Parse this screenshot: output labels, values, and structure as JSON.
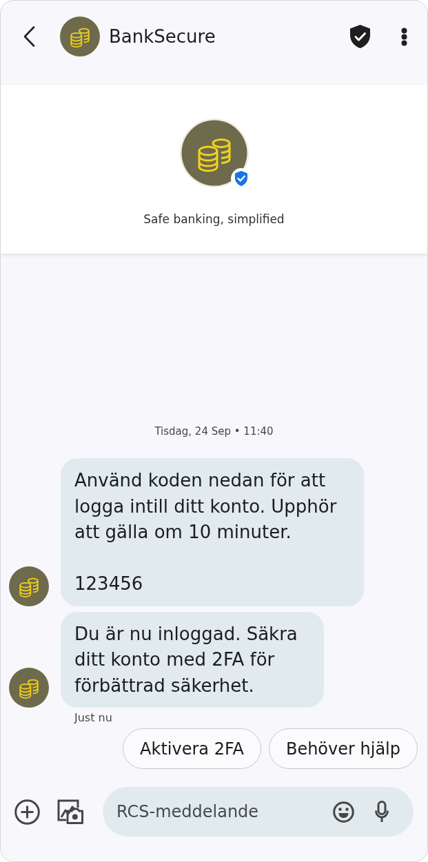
{
  "header": {
    "title": "BankSecure"
  },
  "profile": {
    "tagline": "Safe banking, simplified",
    "verified": true
  },
  "conversation": {
    "timestamp": "Tisdag, 24 Sep • 11:40",
    "messages": [
      {
        "text": "Använd koden nedan för att logga intill ditt konto. Upphör att gälla om 10 minuter.\n\n123456"
      },
      {
        "text": "Du är nu inloggad. Säkra ditt konto med 2FA för förbättrad säkerhet."
      }
    ],
    "status": "Just nu",
    "suggestions": [
      {
        "label": "Aktivera 2FA"
      },
      {
        "label": "Behöver hjälp"
      }
    ]
  },
  "composer": {
    "placeholder": "RCS-meddelande"
  }
}
